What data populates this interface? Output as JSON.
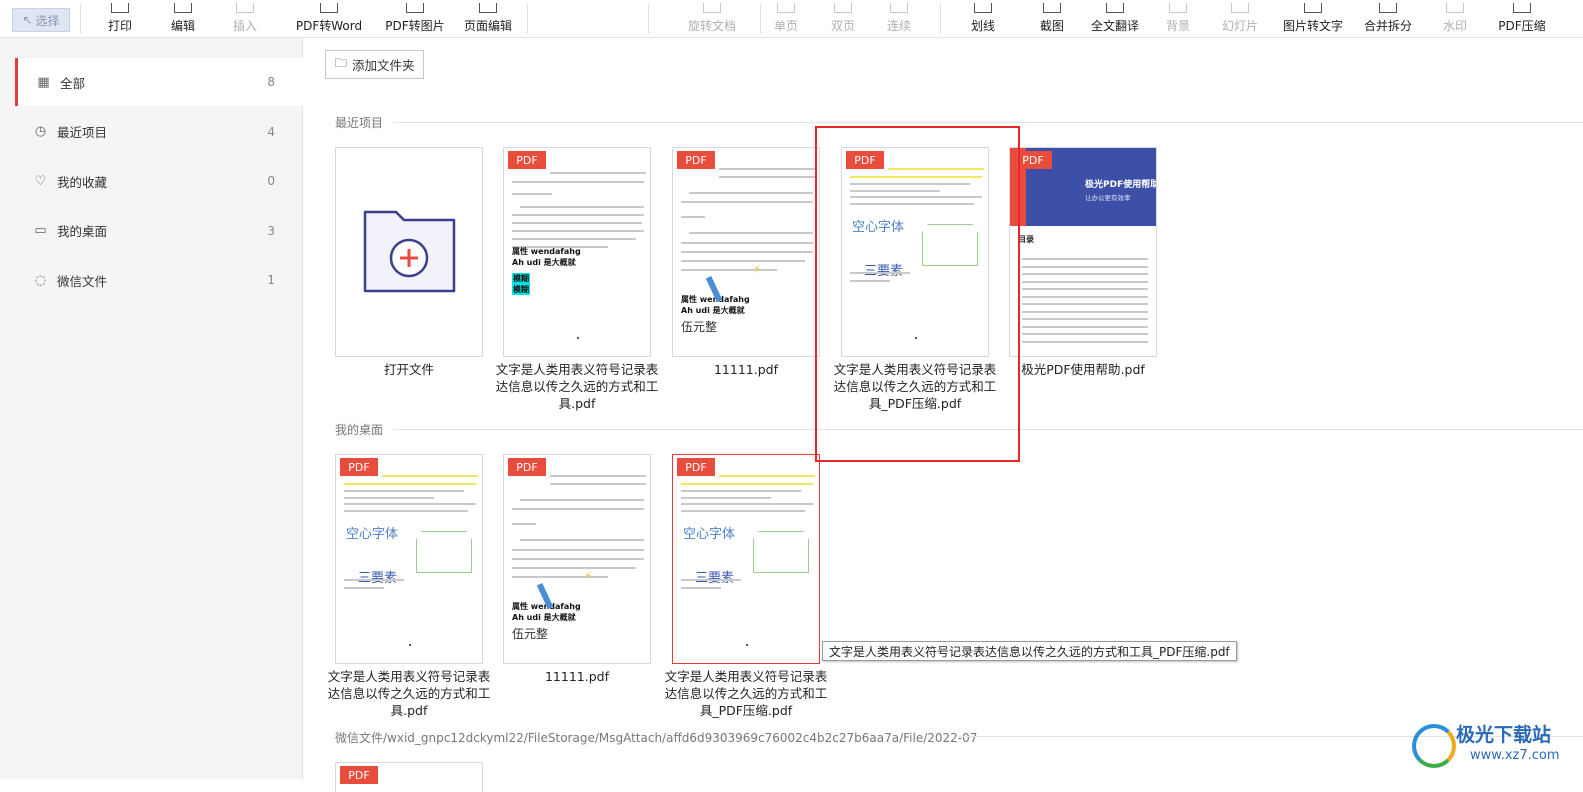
{
  "toolbar": {
    "select_label": "选择",
    "items": [
      {
        "label": "打印",
        "disabled": false
      },
      {
        "label": "编辑",
        "disabled": false
      },
      {
        "label": "插入",
        "disabled": true
      },
      {
        "label": "PDF转Word",
        "disabled": false
      },
      {
        "label": "PDF转图片",
        "disabled": false
      },
      {
        "label": "页面编辑",
        "disabled": false
      },
      {
        "label": "旋转文档",
        "disabled": true
      },
      {
        "label": "单页",
        "disabled": true
      },
      {
        "label": "双页",
        "disabled": true
      },
      {
        "label": "连续",
        "disabled": true
      },
      {
        "label": "划线",
        "disabled": false
      },
      {
        "label": "截图",
        "disabled": false
      },
      {
        "label": "全文翻译",
        "disabled": false
      },
      {
        "label": "背景",
        "disabled": true
      },
      {
        "label": "幻灯片",
        "disabled": true
      },
      {
        "label": "图片转文字",
        "disabled": false
      },
      {
        "label": "合并拆分",
        "disabled": false
      },
      {
        "label": "水印",
        "disabled": true
      },
      {
        "label": "PDF压缩",
        "disabled": false
      }
    ]
  },
  "sidebar": {
    "items": [
      {
        "label": "全部",
        "count": "8",
        "icon": "grid-icon",
        "active": true
      },
      {
        "label": "最近项目",
        "count": "4",
        "icon": "clock-icon",
        "active": false
      },
      {
        "label": "我的收藏",
        "count": "0",
        "icon": "heart-icon",
        "active": false
      },
      {
        "label": "我的桌面",
        "count": "3",
        "icon": "monitor-icon",
        "active": false
      },
      {
        "label": "微信文件",
        "count": "1",
        "icon": "wechat-icon",
        "active": false
      }
    ]
  },
  "main": {
    "add_folder_label": "添加文件夹",
    "recent_title": "最近项目",
    "desktop_title": "我的桌面",
    "wechat_path": "微信文件/wxid_gnpc12dckyml22/FileStorage/MsgAttach/affd6d9303969c76002c4b2c27b6aa7a/File/2022-07",
    "pdf_tag": "PDF",
    "recent_files": [
      {
        "name": "打开文件",
        "kind": "open"
      },
      {
        "name": "文字是人类用表义符号记录表达信息以传之久远的方式和工具.pdf",
        "kind": "doc1"
      },
      {
        "name": "11111.pdf",
        "kind": "doc2"
      },
      {
        "name": "文字是人类用表义符号记录表达信息以传之久远的方式和工具_PDF压缩.pdf",
        "kind": "doc3"
      },
      {
        "name": "极光PDF使用帮助.pdf",
        "kind": "help"
      }
    ],
    "desktop_files": [
      {
        "name": "文字是人类用表义符号记录表达信息以传之久远的方式和工具.pdf",
        "kind": "doc3"
      },
      {
        "name": "11111.pdf",
        "kind": "doc2"
      },
      {
        "name": "文字是人类用表义符号记录表达信息以传之久远的方式和工具_PDF压缩.pdf",
        "kind": "doc3"
      }
    ],
    "tooltip": "文字是人类用表义符号记录表达信息以传之久远的方式和工具_PDF压缩.pdf"
  },
  "thumbnail_text": {
    "bold1": "属性 wendafahg",
    "bold2": "Ah udi 是大概就",
    "cyan1": "模糊",
    "cyan2": "模糊",
    "big": "伍元整",
    "hollow": "空心字体",
    "sanyao": "三要素",
    "help_title": "极光PDF使用帮助",
    "help_sub": "让办公更有效率",
    "help_toc": "目录"
  },
  "watermark": {
    "text": "极光下载站",
    "url": "www.xz7.com"
  },
  "colors": {
    "accent": "#e03a3a",
    "pdf_tag": "#e74c3c",
    "help_cover": "#3d4fa6"
  }
}
